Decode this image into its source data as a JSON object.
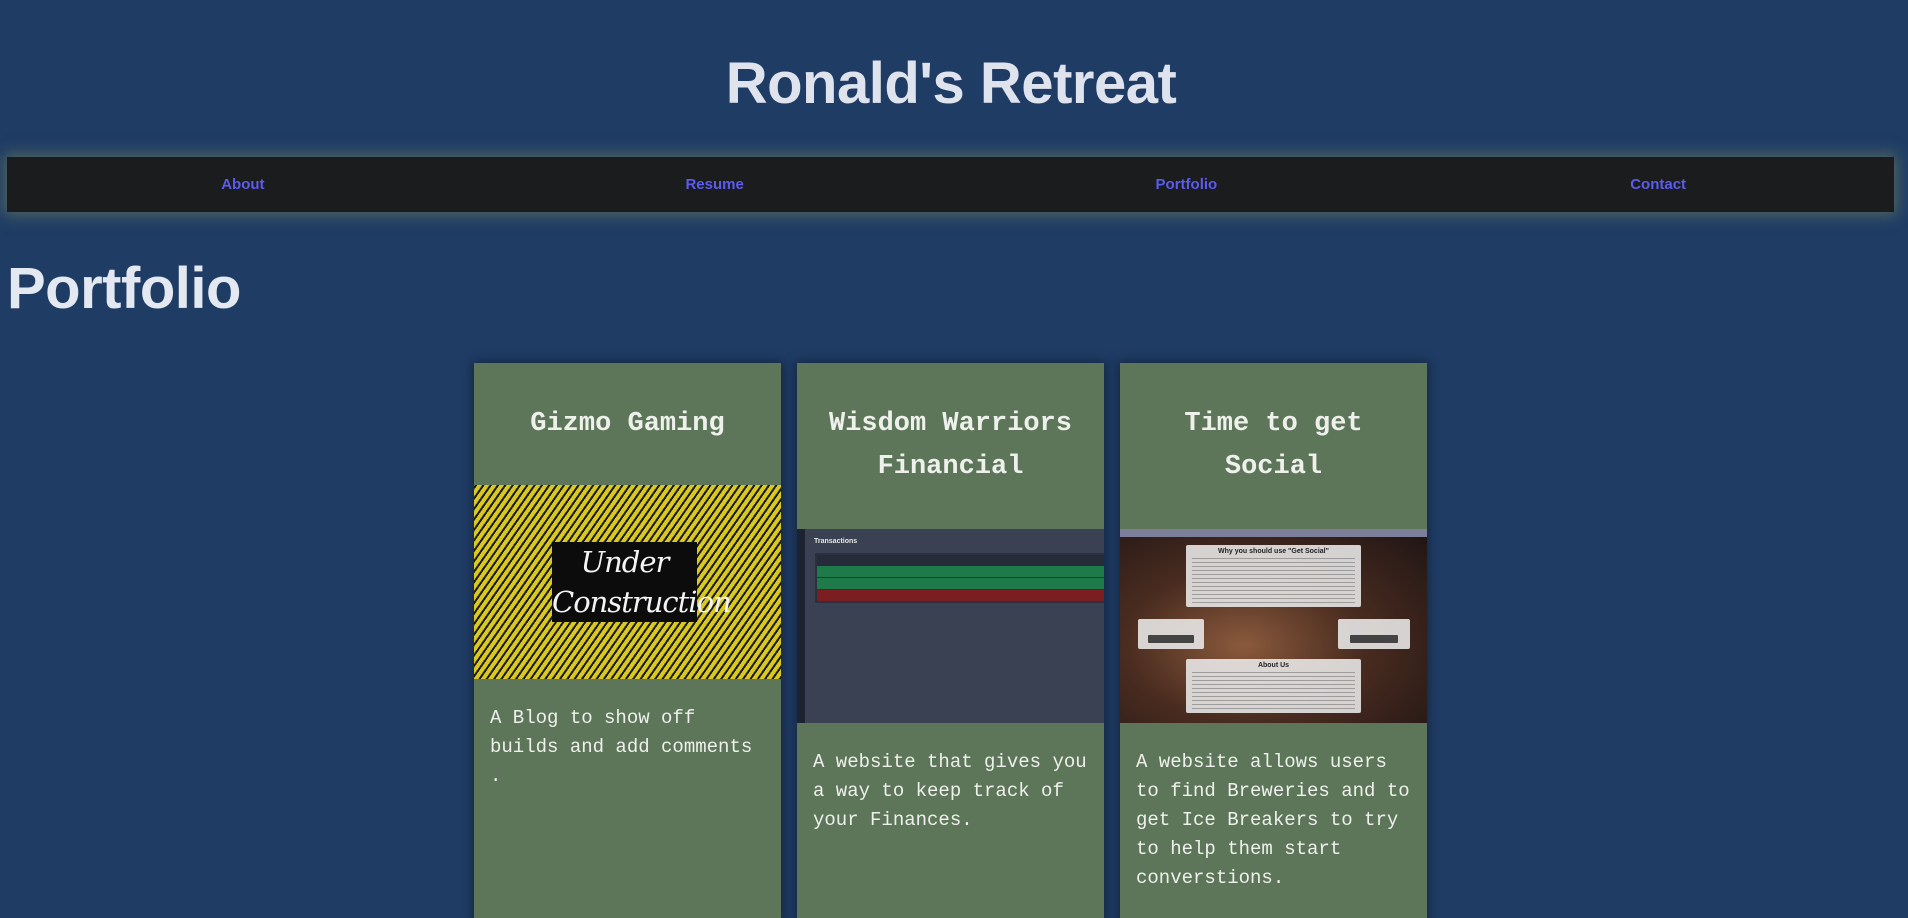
{
  "site": {
    "title": "Ronald's Retreat"
  },
  "nav": {
    "items": [
      {
        "label": "About"
      },
      {
        "label": "Resume"
      },
      {
        "label": "Portfolio"
      },
      {
        "label": "Contact"
      }
    ]
  },
  "portfolio": {
    "heading": "Portfolio",
    "cards": [
      {
        "title": "Gizmo Gaming",
        "image_text": [
          "Under",
          "Construction"
        ],
        "description": "A Blog to show off builds and add comments ."
      },
      {
        "title": "Wisdom Warriors Financial",
        "image_title": "Transactions",
        "description": "A website that gives you a way to keep track of your Finances."
      },
      {
        "title": "Time to get Social",
        "image_heading": "Why you should use \"Get Social\"",
        "image_about": "About Us",
        "description": "A website allows users to find Breweries and to get Ice Breakers to try to help them start converstions."
      }
    ]
  },
  "colors": {
    "page_background": "#1f3c65",
    "nav_background": "#1b1c1d",
    "nav_link": "#5b5bf0",
    "card_background": "#5d7659"
  }
}
